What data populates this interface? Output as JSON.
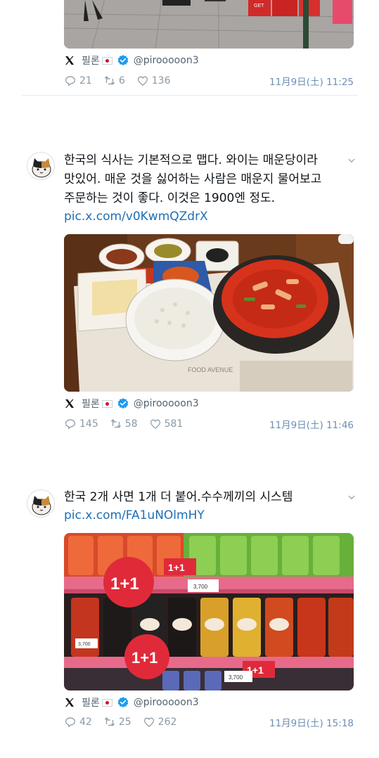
{
  "tweets": [
    {
      "author": "필론",
      "handle": "@pirooooon3",
      "replies": "21",
      "retweets": "6",
      "likes": "136",
      "timestamp": "11月9日(土) 11:25"
    },
    {
      "author": "필론",
      "handle": "@pirooooon3",
      "text_lines": [
        "한국의 식사는 기본적으로 맵다. 와이는 매운당이라",
        "맛있어. 매운 것을 싫어하는 사람은 매운지 물어보고",
        "주문하는 것이 좋다. 이것은 1900엔 정도."
      ],
      "link": "pic.x.com/v0KwmQZdrX",
      "image_caption": "FOOD AVENUE",
      "replies": "145",
      "retweets": "58",
      "likes": "581",
      "timestamp": "11月9日(土) 11:46"
    },
    {
      "author": "필론",
      "handle": "@pirooooon3",
      "text_lines": [
        "한국 2개 사면 1개 더 붙어.수수께끼의 시스템"
      ],
      "link": "pic.x.com/FA1uNOlmHY",
      "image_signs": [
        "1+1",
        "1+1",
        "1+1",
        "1+1"
      ],
      "price_tags": [
        "3,700",
        "3,700",
        "3,700"
      ],
      "replies": "42",
      "retweets": "25",
      "likes": "262",
      "timestamp": "11月9日(土) 15:18"
    }
  ],
  "icons": [
    "x-logo-icon",
    "japan-flag-icon",
    "verified-badge-icon",
    "reply-icon",
    "retweet-icon",
    "like-icon",
    "chevron-down-icon"
  ],
  "colors": {
    "verified": "#1d9bf0",
    "link": "#1d6fb5",
    "muted": "#536471",
    "time": "#6c8fb5"
  }
}
